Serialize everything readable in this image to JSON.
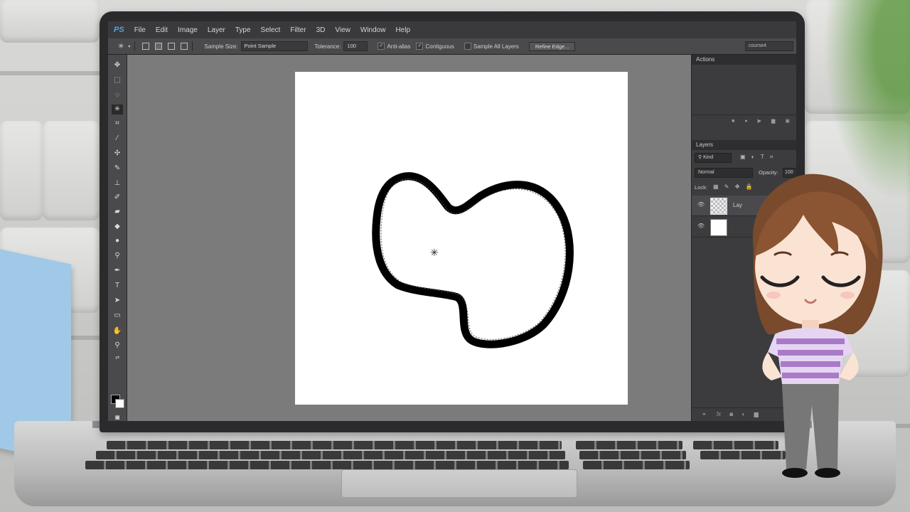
{
  "app": {
    "logo": "PS",
    "menus": [
      "File",
      "Edit",
      "Image",
      "Layer",
      "Type",
      "Select",
      "Filter",
      "3D",
      "View",
      "Window",
      "Help"
    ]
  },
  "options_bar": {
    "sample_size_label": "Sample Size:",
    "sample_size_value": "Point Sample",
    "tolerance_label": "Tolerance:",
    "tolerance_value": "100",
    "anti_alias_label": "Anti-alias",
    "anti_alias_checked": true,
    "contiguous_label": "Contiguous",
    "contiguous_checked": true,
    "sample_all_layers_label": "Sample All Layers",
    "sample_all_layers_checked": false,
    "refine_edge_label": "Refine Edge...",
    "workspace_value": "course4"
  },
  "panels": {
    "actions_title": "Actions",
    "layers_title": "Layers",
    "kind_filter": "Kind",
    "blend_mode": "Normal",
    "opacity_label": "Opacity:",
    "opacity_value": "100",
    "lock_label": "Lock:",
    "layers": [
      {
        "name": "Lay",
        "thumbnail": "transparent"
      },
      {
        "name": "",
        "thumbnail": "white"
      }
    ]
  },
  "icons": {
    "active_tool": "magic-wand-icon"
  }
}
